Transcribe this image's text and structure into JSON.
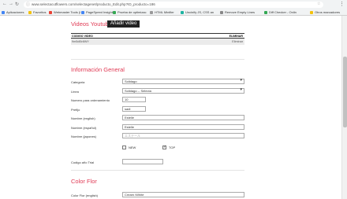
{
  "browser": {
    "url": "www.selectacutflowers.com/selectagenet/producto_Edit.php?ID_producto=186",
    "bookmarks": [
      "Aplicaciones",
      "Favoritos",
      "Webmaster Tools (I",
      "PageSpeed Insights",
      "Prueba de optimizac",
      "HTML Minifier",
      "Uncinify JS, CSS an",
      "Remove Empty Lines",
      "Diff Checker - Onlin",
      "Otros marcadores"
    ]
  },
  "videos": {
    "title": "Videos Youtube",
    "add_button": "Añadir video",
    "col_code": "CODIGO VIDEO",
    "col_remove": "ELIMINAR",
    "rows": [
      {
        "code": "9m5dl5r8WY",
        "action": "Eliminar"
      }
    ]
  },
  "general": {
    "title": "Información General",
    "fields": {
      "categoria": {
        "label": "Categoria",
        "value": "Solidago"
      },
      "linea": {
        "label": "Linea",
        "value": "Solidago -- Selecta"
      },
      "orden": {
        "label": "Numero para ordenamiento",
        "value": "10"
      },
      "prefijo": {
        "label": "Prefijo",
        "value": "sadi"
      },
      "nombre_en": {
        "label": "Nombre (english)",
        "value": "Estelle"
      },
      "nombre_es": {
        "label": "Nombre (español)",
        "value": "Estelle"
      },
      "nombre_ja": {
        "label": "Nombre (japones)",
        "placeholder": "エステール"
      }
    },
    "new_label": "NEW",
    "top_label": "TOP",
    "new_checked": false,
    "top_checked": true,
    "codigo_trial_label": "Codigo año Trial"
  },
  "color": {
    "title": "Color Flor",
    "label": "Color Flor (english)",
    "value": "Cream /White"
  }
}
